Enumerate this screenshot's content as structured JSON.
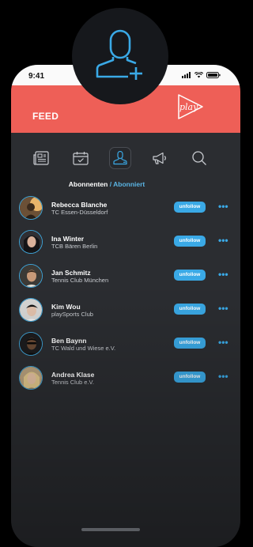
{
  "status_bar": {
    "time": "9:41"
  },
  "header": {
    "title": "FEED",
    "logo_text": "play"
  },
  "nav": {
    "items": [
      {
        "icon": "newspaper-icon"
      },
      {
        "icon": "calendar-check-icon"
      },
      {
        "icon": "user-icon",
        "active": true
      },
      {
        "icon": "megaphone-icon"
      },
      {
        "icon": "search-icon"
      }
    ]
  },
  "tabs": {
    "followers": "Abonnenten",
    "separator": "/",
    "following": "Abonniert"
  },
  "badge": {
    "icon": "add-user-icon"
  },
  "button_label": "unfollow",
  "more_label": "•••",
  "users": [
    {
      "name": "Rebecca Blanche",
      "club": "TC Essen-Düsseldorf"
    },
    {
      "name": "Ina Winter",
      "club": "TCB Bären Berlin"
    },
    {
      "name": "Jan Schmitz",
      "club": "Tennis Club München"
    },
    {
      "name": "Kim Wou",
      "club": "playSports Club"
    },
    {
      "name": "Ben Baynn",
      "club": "TC Wald und Wiese e.V."
    },
    {
      "name": "Andrea Klase",
      "club": "Tennis Club e.V."
    }
  ],
  "colors": {
    "header": "#ee5f57",
    "accent": "#3aa9e6",
    "card": "#2b2d31"
  }
}
